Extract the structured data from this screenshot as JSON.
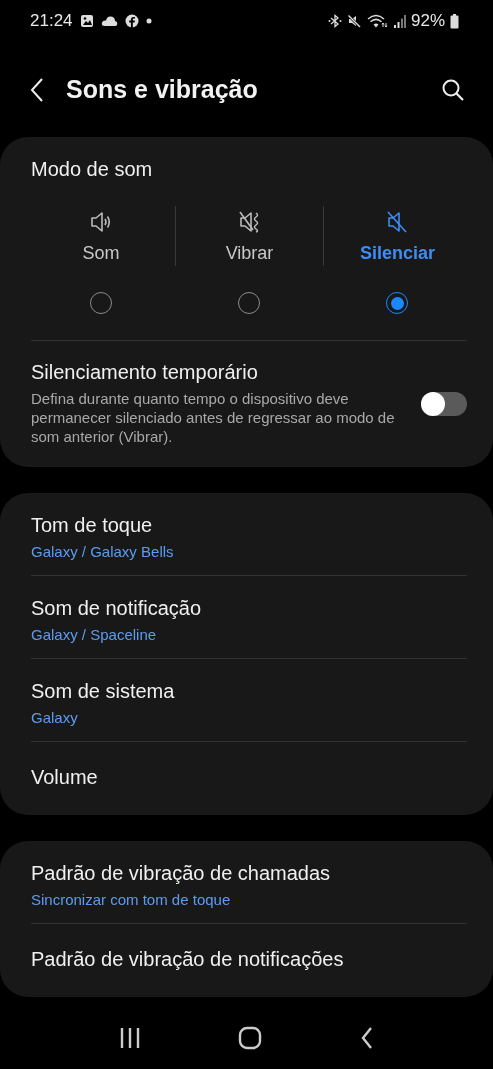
{
  "status_bar": {
    "time": "21:24",
    "battery": "92%"
  },
  "header": {
    "title": "Sons e vibração"
  },
  "sound_mode": {
    "title": "Modo de som",
    "modes": [
      {
        "kind": "sound",
        "label": "Som",
        "selected": false
      },
      {
        "kind": "vibrate",
        "label": "Vibrar",
        "selected": false
      },
      {
        "kind": "mute",
        "label": "Silenciar",
        "selected": true
      }
    ]
  },
  "temporary_mute": {
    "title": "Silenciamento temporário",
    "description": "Defina durante quanto tempo o dispositivo deve permanecer silenciado antes de regressar ao modo de som anterior (Vibrar).",
    "on": false
  },
  "groups": [
    {
      "items": [
        {
          "title": "Tom de toque",
          "subtitle": "Galaxy / Galaxy Bells"
        },
        {
          "title": "Som de notificação",
          "subtitle": "Galaxy / Spaceline"
        },
        {
          "title": "Som de sistema",
          "subtitle": "Galaxy"
        },
        {
          "title": "Volume"
        }
      ]
    },
    {
      "items": [
        {
          "title": "Padrão de vibração de chamadas",
          "subtitle": "Sincronizar com tom de toque"
        },
        {
          "title": "Padrão de vibração de notificações"
        }
      ]
    }
  ]
}
